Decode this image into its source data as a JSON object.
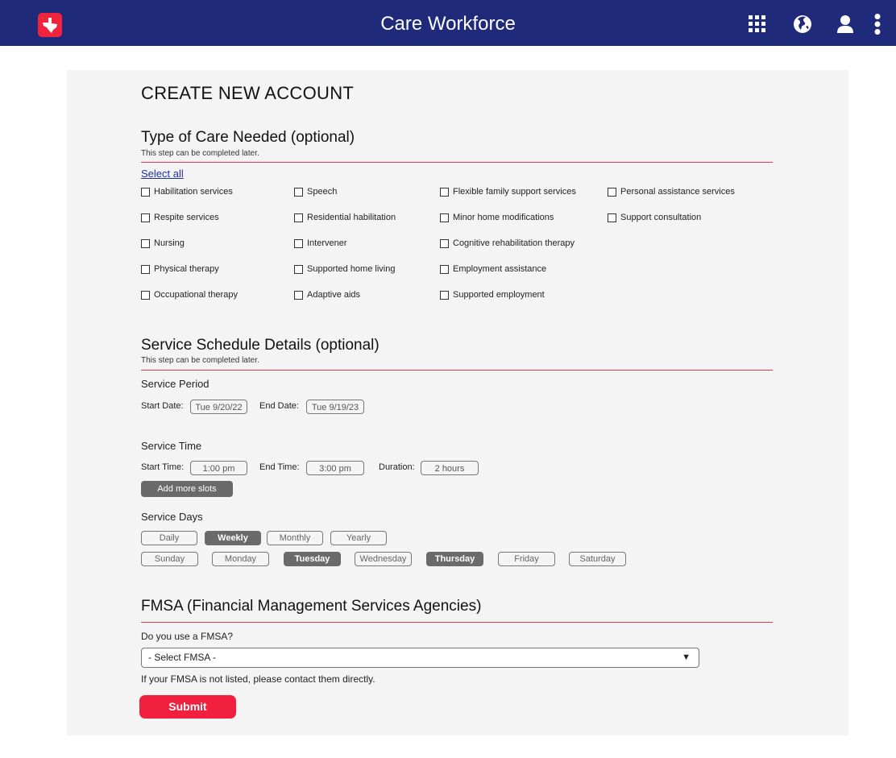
{
  "header": {
    "title": "Care Workforce",
    "logo_icon": "texas-state-icon",
    "icons": [
      "apps-grid-icon",
      "globe-icon",
      "user-icon",
      "more-vertical-icon"
    ],
    "color": "#1f2a7a",
    "accent": "#f0243d"
  },
  "page": {
    "title": "CREATE NEW ACCOUNT"
  },
  "care": {
    "title": "Type of Care Needed (optional)",
    "subtitle": "This step can be completed later.",
    "select_all": "Select all",
    "columns": [
      [
        "Habilitation services",
        "Respite services",
        "Nursing",
        "Physical therapy",
        "Occupational therapy"
      ],
      [
        "Speech",
        "Residential habilitation",
        "Intervener",
        "Supported home living",
        "Adaptive aids"
      ],
      [
        "Flexible family support services",
        "Minor home modifications",
        "Cognitive rehabilitation therapy",
        "Employment assistance",
        "Supported employment"
      ],
      [
        "Personal assistance services",
        "Support consultation"
      ]
    ]
  },
  "schedule": {
    "title": "Service Schedule Details (optional)",
    "subtitle": "This step can be completed later.",
    "period": {
      "label": "Service Period",
      "start_label": "Start Date:",
      "start_value": "Tue 9/20/22",
      "end_label": "End Date:",
      "end_value": "Tue 9/19/23"
    },
    "time": {
      "label": "Service Time",
      "start_label": "Start Time:",
      "start_value": "1:00 pm",
      "end_label": "End Time:",
      "end_value": "3:00 pm",
      "duration_label": "Duration:",
      "duration_value": "2 hours",
      "add_slots": "Add more slots"
    },
    "days": {
      "label": "Service  Days",
      "frequency": [
        {
          "label": "Daily",
          "active": false
        },
        {
          "label": "Weekly",
          "active": true
        },
        {
          "label": "Monthly",
          "active": false
        },
        {
          "label": "Yearly",
          "active": false
        }
      ],
      "weekdays": [
        {
          "label": "Sunday",
          "active": false
        },
        {
          "label": "Monday",
          "active": false
        },
        {
          "label": "Tuesday",
          "active": true
        },
        {
          "label": "Wednesday",
          "active": false
        },
        {
          "label": "Thursday",
          "active": true
        },
        {
          "label": "Friday",
          "active": false
        },
        {
          "label": "Saturday",
          "active": false
        }
      ]
    }
  },
  "fmsa": {
    "title": "FMSA (Financial Management Services Agencies)",
    "question": "Do you use a FMSA?",
    "select_value": "- Select FMSA -",
    "help": "If your FMSA is not listed, please contact them directly.",
    "submit": "Submit"
  }
}
